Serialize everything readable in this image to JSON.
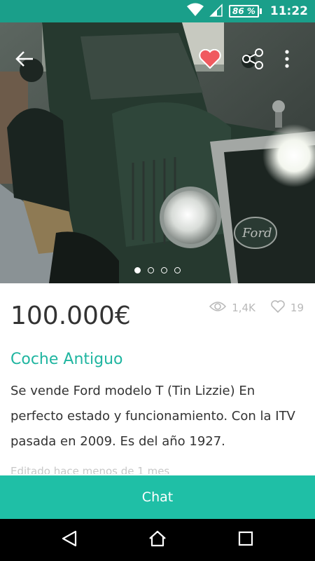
{
  "status_bar": {
    "battery_percent": "86 %",
    "time": "11:22",
    "icons": [
      "wifi-icon",
      "signal-icon",
      "battery-icon"
    ]
  },
  "header": {
    "icons": [
      "back-arrow-icon",
      "heart-icon",
      "share-icon",
      "more-vert-icon"
    ],
    "favorite_color": "#f05a5f"
  },
  "gallery": {
    "image_count": 4,
    "active_index": 0
  },
  "listing": {
    "price": "100.000€",
    "views": "1,4K",
    "favorites": "19",
    "title": "Coche Antiguo",
    "description": "Se vende Ford modelo T (Tin Lizzie) En perfecto estado y funcionamiento. Con la ITV pasada en 2009. Es del año 1927.",
    "edited": "Editado hace menos de 1 mes"
  },
  "chat": {
    "label": "Chat"
  },
  "colors": {
    "status_bar": "#1a9f8a",
    "accent": "#1fb5a0",
    "chat_button": "#1fbfa6"
  },
  "nav_bar": {
    "icons": [
      "back-triangle-icon",
      "home-icon",
      "recents-square-icon"
    ]
  }
}
